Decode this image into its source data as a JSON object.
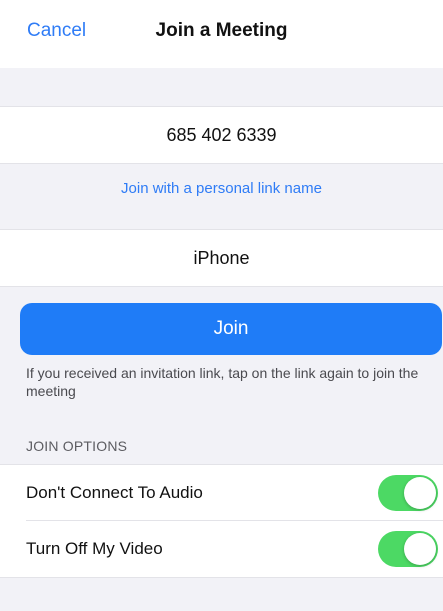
{
  "nav": {
    "cancel_label": "Cancel",
    "title": "Join a Meeting"
  },
  "meeting": {
    "id_value": "685 402 6339",
    "personal_link_label": "Join with a personal link name",
    "name_value": "iPhone"
  },
  "join": {
    "button_label": "Join",
    "hint": "If you received an invitation link, tap on the link again to join the meeting"
  },
  "options": {
    "section_title": "JOIN OPTIONS",
    "items": [
      {
        "label": "Don't Connect To Audio",
        "enabled": true
      },
      {
        "label": "Turn Off My Video",
        "enabled": true
      }
    ]
  },
  "colors": {
    "accent_blue": "#1f7cf7",
    "toggle_on": "#4cd964",
    "background": "#f2f2f7"
  }
}
